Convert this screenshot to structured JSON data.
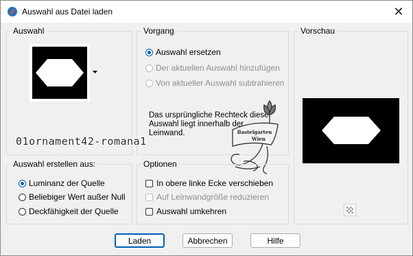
{
  "window": {
    "title": "Auswahl aus Datei laden",
    "close_glyph": "✕"
  },
  "groups": {
    "auswahl": {
      "label": "Auswahl"
    },
    "vorgang": {
      "label": "Vorgang",
      "options": [
        {
          "label": "Auswahl ersetzen",
          "checked": true,
          "disabled": false
        },
        {
          "label": "Der aktuellen Auswahl hinzufügen",
          "checked": false,
          "disabled": true
        },
        {
          "label": "Von aktueller Auswahl subtrahieren",
          "checked": false,
          "disabled": true
        }
      ],
      "info": "Das ursprüngliche Rechteck dieser Auswahl liegt innerhalb der Leinwand."
    },
    "vorschau": {
      "label": "Vorschau"
    },
    "erstellen": {
      "label": "Auswahl erstellen aus:",
      "options": [
        {
          "label": "Luminanz der Quelle",
          "checked": true
        },
        {
          "label": "Beliebiger Wert außer Null",
          "checked": false
        },
        {
          "label": "Deckfähigkeit der Quelle",
          "checked": false
        }
      ]
    },
    "optionen": {
      "label": "Optionen",
      "checks": [
        {
          "label": "In obere linke Ecke verschieben",
          "checked": false,
          "disabled": false
        },
        {
          "label": "Auf Leinwandgröße reduzieren",
          "checked": false,
          "disabled": true
        },
        {
          "label": "Auswahl umkehren",
          "checked": false,
          "disabled": false
        }
      ]
    }
  },
  "watermark_text": "01ornament42-romana1",
  "stamp_text": "Bastelgarten Wien",
  "buttons": {
    "load": "Laden",
    "cancel": "Abbrechen",
    "help": "Hilfe"
  },
  "colors": {
    "accent": "#005fb8",
    "preview_bg": "#000000",
    "shape": "#ffffff"
  }
}
